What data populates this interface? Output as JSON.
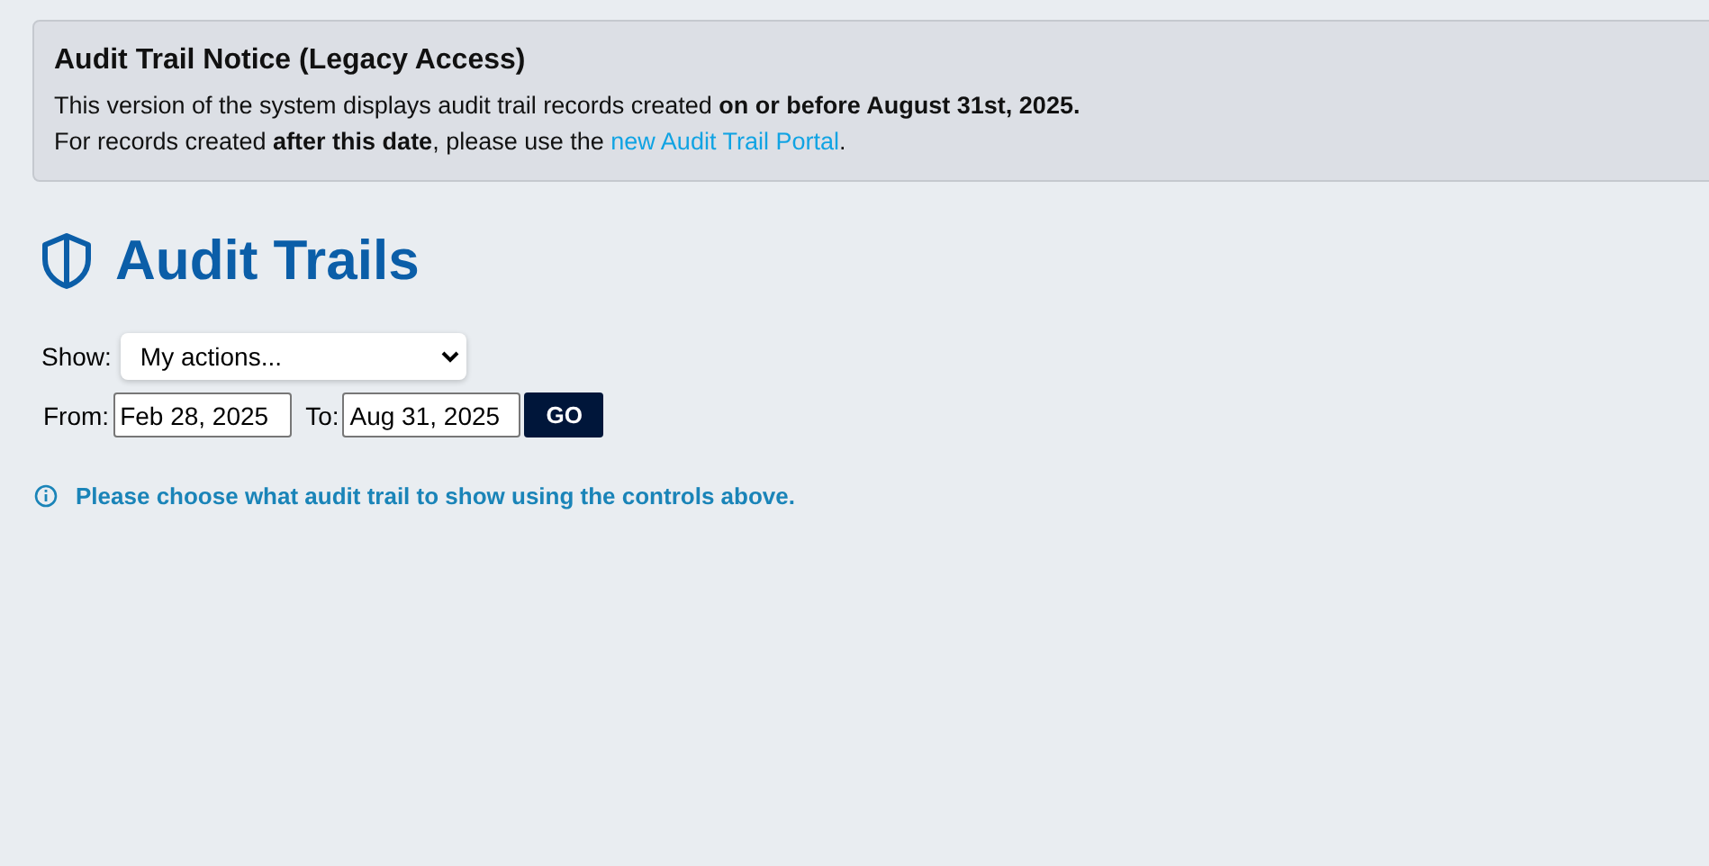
{
  "notice": {
    "title": "Audit Trail Notice (Legacy Access)",
    "line_1": "This version of the system displays audit trail records created **on or before August 31st, 2025.**",
    "line_2_before": "For records created **after this date**, please use the ",
    "link": "new Audit Trail Portal",
    "line_2_after": "."
  },
  "page": {
    "title": "Audit Trails"
  },
  "filters": {
    "show_label": "Show:",
    "show_value": "My actions...",
    "from_label": "From:",
    "from_value": "Feb 28, 2025",
    "to_label": "To:",
    "to_value": "Aug 31, 2025",
    "go_button": "GO"
  },
  "info_message": "Please choose what audit trail to show using the controls above."
}
